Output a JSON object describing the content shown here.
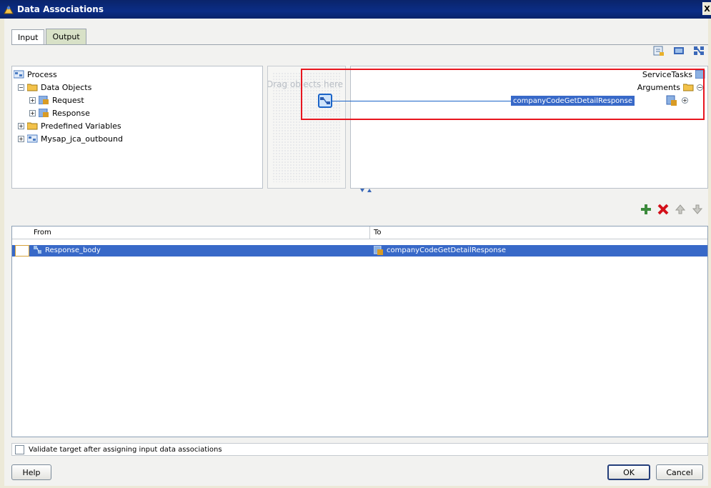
{
  "window": {
    "title": "Data Associations",
    "close_glyph": "X"
  },
  "tabs": [
    {
      "label": "Input"
    },
    {
      "label": "Output"
    }
  ],
  "source_tree": {
    "root": "Process",
    "data_objects": "Data Objects",
    "request": "Request",
    "response": "Response",
    "predefined": "Predefined Variables",
    "mysap": "Mysap_jca_outbound"
  },
  "dropzone": {
    "hint": "Drag objects here"
  },
  "target_tree": {
    "service_tasks": "ServiceTasks",
    "arguments": "Arguments",
    "selected": "companyCodeGetDetailResponse"
  },
  "grid": {
    "col_from": "From",
    "col_to": "To",
    "rows": [
      {
        "from": "Response_body",
        "to": "companyCodeGetDetailResponse"
      }
    ]
  },
  "validate_label": "Validate target after assigning input data associations",
  "buttons": {
    "help": "Help",
    "ok": "OK",
    "cancel": "Cancel"
  },
  "icons": {
    "toolbar_top": [
      "expression-icon",
      "xml-literal-icon",
      "transformation-icon"
    ],
    "toolbar_mid": [
      "add-icon",
      "delete-icon",
      "move-up-icon",
      "move-down-icon"
    ]
  },
  "colors": {
    "selection": "#3869c8",
    "highlight": "#e8161f",
    "title_bar": "#0a246a"
  }
}
